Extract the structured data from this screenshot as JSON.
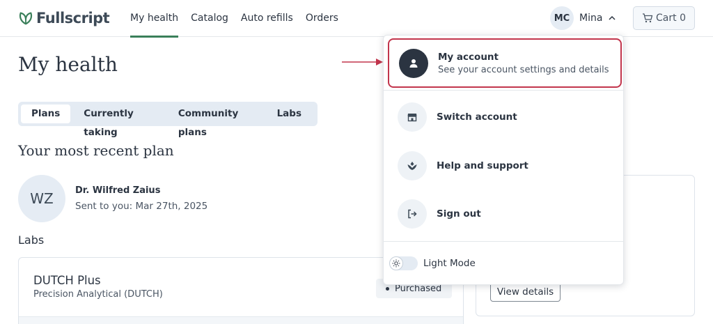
{
  "header": {
    "logo_text": "Fullscript",
    "nav": [
      {
        "label": "My health",
        "active": true
      },
      {
        "label": "Catalog",
        "active": false
      },
      {
        "label": "Auto refills",
        "active": false
      },
      {
        "label": "Orders",
        "active": false
      }
    ],
    "user_initials": "MC",
    "user_name": "Mina",
    "cart_label": "Cart 0"
  },
  "main": {
    "page_title": "My health",
    "tabs": [
      "Plans",
      "Currently taking",
      "Community plans",
      "Labs"
    ],
    "active_tab": "Plans",
    "recent_plan": {
      "section_title": "Your most recent plan",
      "initials": "WZ",
      "doctor": "Dr. Wilfred Zaius",
      "sent": "Sent to you: Mar 27th, 2025"
    },
    "labs": {
      "heading": "Labs",
      "card": {
        "name": "DUTCH Plus",
        "provider": "Precision Analytical (DUTCH)",
        "status": "Purchased"
      }
    },
    "side_card": {
      "button_label": "View details"
    }
  },
  "dropdown": {
    "account": {
      "title": "My account",
      "subtitle": "See your account settings and details"
    },
    "items": [
      {
        "label": "Switch account",
        "icon": "store-icon"
      },
      {
        "label": "Help and support",
        "icon": "help-hands-icon"
      },
      {
        "label": "Sign out",
        "icon": "sign-out-icon"
      }
    ],
    "mode_label": "Light Mode"
  },
  "colors": {
    "accent_green": "#3a7f5a",
    "highlight_red": "#c2354c",
    "text_dark": "#2b3441"
  }
}
